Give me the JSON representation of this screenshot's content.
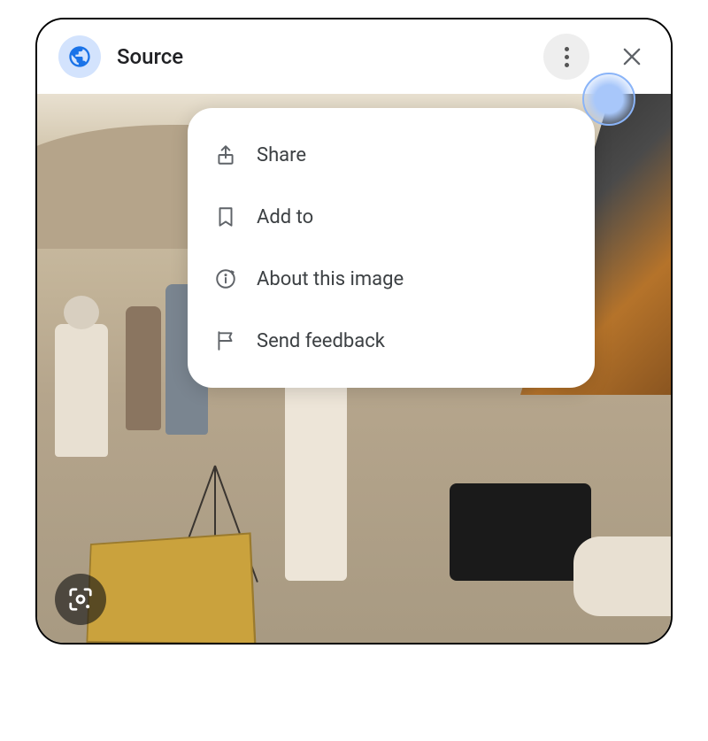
{
  "header": {
    "source_label": "Source"
  },
  "menu": {
    "items": [
      {
        "icon": "share-icon",
        "label": "Share"
      },
      {
        "icon": "bookmark-icon",
        "label": "Add to"
      },
      {
        "icon": "info-icon",
        "label": "About this image"
      },
      {
        "icon": "flag-icon",
        "label": "Send feedback"
      }
    ]
  },
  "colors": {
    "accent": "#1a73e8",
    "highlight": "#a8c7fa",
    "text": "#3c4043"
  }
}
